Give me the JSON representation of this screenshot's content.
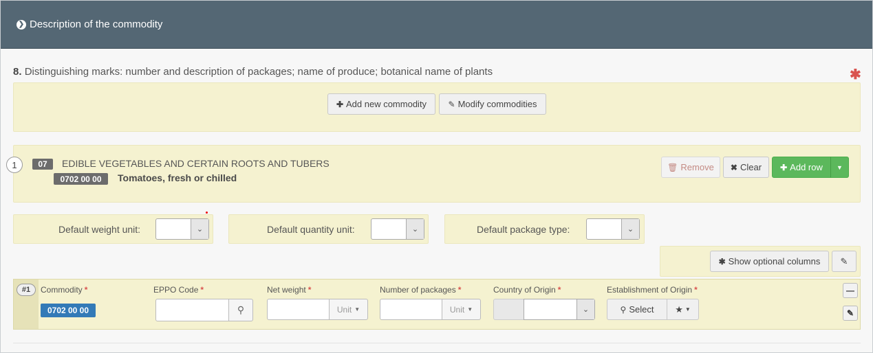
{
  "header": {
    "title": "Description of the commodity"
  },
  "section": {
    "number": "8.",
    "label": "Distinguishing marks: number and description of packages; name of produce; botanical name of plants",
    "required_mark": "✱"
  },
  "toolbar": {
    "add_commodity_label": "Add new commodity",
    "modify_commodities_label": "Modify commodities"
  },
  "commodity": {
    "index": "1",
    "chapter_code": "07",
    "chapter_name": "EDIBLE VEGETABLES AND CERTAIN ROOTS AND TUBERS",
    "cn_code": "0702 00 00",
    "cn_name": "Tomatoes, fresh or chilled",
    "remove_label": "Remove",
    "clear_label": "Clear",
    "add_row_label": "Add row"
  },
  "defaults": {
    "weight_unit_label": "Default weight unit:",
    "quantity_unit_label": "Default quantity unit:",
    "package_type_label": "Default package type:"
  },
  "optional": {
    "show_optional_columns_label": "Show optional columns"
  },
  "grid": {
    "row_number": "#1",
    "columns": {
      "commodity": "Commodity",
      "eppo_code": "EPPO Code",
      "net_weight": "Net weight",
      "number_of_packages": "Number of packages",
      "country_of_origin": "Country of Origin",
      "establishment_of_origin": "Establishment of Origin"
    },
    "row": {
      "commodity_code": "0702 00 00",
      "eppo_code": "",
      "net_weight": "",
      "net_weight_unit": "Unit",
      "number_of_packages": "",
      "packages_unit": "Unit",
      "select_label": "Select"
    }
  },
  "colors": {
    "header_bg": "#546774",
    "panel_yellow": "#f5f2d0",
    "required_red": "#d9534f",
    "primary_blue": "#337ab7",
    "success_green": "#5cb85c"
  }
}
